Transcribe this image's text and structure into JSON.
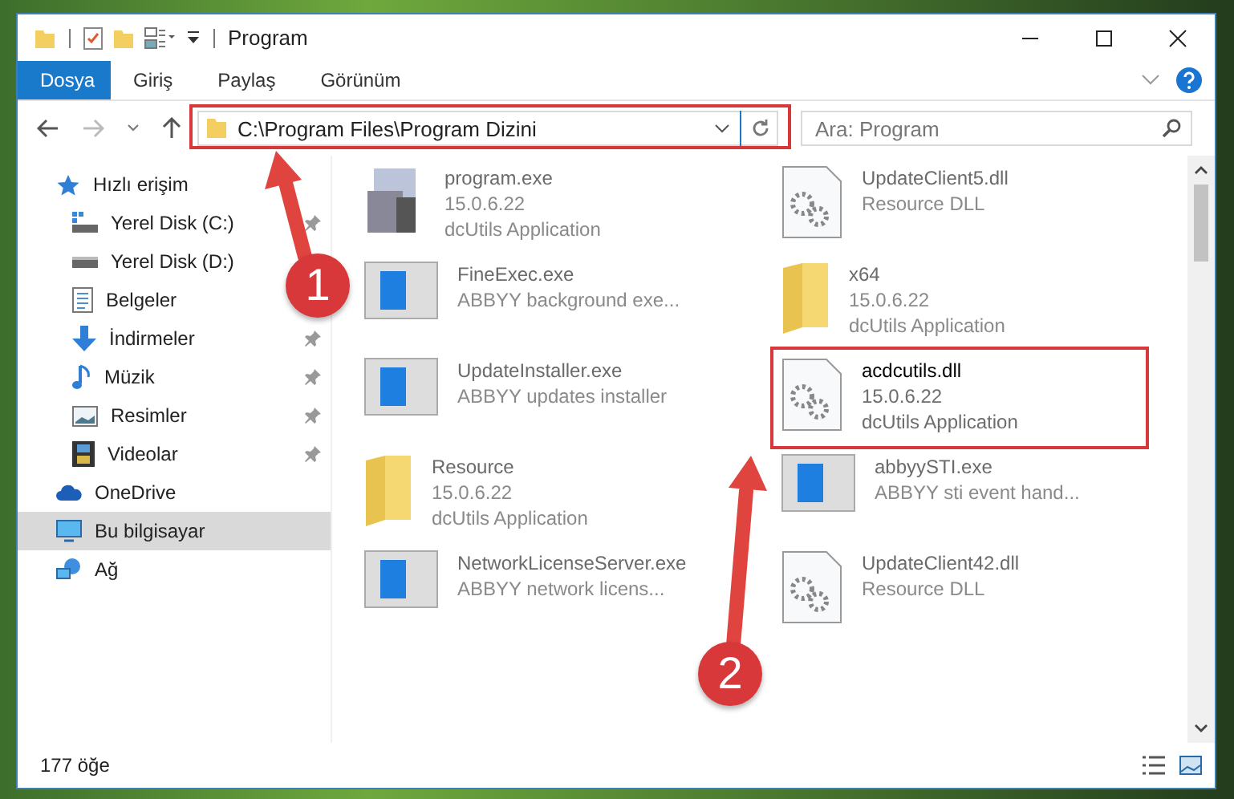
{
  "window": {
    "title": "Program"
  },
  "ribbon_tabs": [
    {
      "label": "Dosya",
      "selected": true
    },
    {
      "label": "Giriş",
      "selected": false
    },
    {
      "label": "Paylaş",
      "selected": false
    },
    {
      "label": "Görünüm",
      "selected": false
    }
  ],
  "address": {
    "path": "C:\\Program Files\\Program Dizini"
  },
  "search": {
    "placeholder": "Ara: Program"
  },
  "nav": [
    {
      "label": "Hızlı erişim",
      "kind": "star",
      "selected": false,
      "children": [
        {
          "label": "Yerel Disk (C:)",
          "kind": "system-drive",
          "pinned": true
        },
        {
          "label": "Yerel Disk (D:)",
          "kind": "drive",
          "pinned": false
        },
        {
          "label": "Belgeler",
          "kind": "documents",
          "pinned": false
        },
        {
          "label": "İndirmeler",
          "kind": "downloads",
          "pinned": true
        },
        {
          "label": "Müzik",
          "kind": "music",
          "pinned": true
        },
        {
          "label": "Resimler",
          "kind": "pictures",
          "pinned": true
        },
        {
          "label": "Videolar",
          "kind": "videos",
          "pinned": true
        }
      ]
    },
    {
      "label": "OneDrive",
      "kind": "cloud",
      "selected": false
    },
    {
      "label": "Bu bilgisayar",
      "kind": "computer",
      "selected": true
    },
    {
      "label": "Ağ",
      "kind": "network",
      "selected": false
    }
  ],
  "files": [
    {
      "kind": "exe",
      "name": "program.exe",
      "lines": [
        "15.0.6.22",
        "dcUtils Application"
      ],
      "blurred": true
    },
    {
      "kind": "dll",
      "name": "UpdateClient5.dll",
      "lines": [
        "Resource DLL"
      ],
      "blurred": true
    },
    {
      "kind": "app",
      "name": "FineExec.exe",
      "lines": [
        "ABBYY background exe..."
      ],
      "blurred": true
    },
    {
      "kind": "folder",
      "name": "x64",
      "lines": [
        "15.0.6.22",
        "dcUtils Application"
      ],
      "blurred": true
    },
    {
      "kind": "app",
      "name": "UpdateInstaller.exe",
      "lines": [
        "ABBYY updates installer"
      ],
      "blurred": true
    },
    {
      "kind": "dll",
      "name": "acdcutils.dll",
      "lines": [
        "15.0.6.22",
        "dcUtils Application"
      ],
      "blurred": false
    },
    {
      "kind": "folder",
      "name": "Resource",
      "lines": [
        "15.0.6.22",
        "dcUtils Application"
      ],
      "blurred": true
    },
    {
      "kind": "app",
      "name": "abbyySTI.exe",
      "lines": [
        "ABBYY sti event hand..."
      ],
      "blurred": true
    },
    {
      "kind": "app",
      "name": "NetworkLicenseServer.exe",
      "lines": [
        "ABBYY network licens..."
      ],
      "blurred": true
    },
    {
      "kind": "dll",
      "name": "UpdateClient42.dll",
      "lines": [
        "Resource DLL"
      ],
      "blurred": true
    }
  ],
  "status_bar": {
    "count": "177 öğe"
  },
  "annotations": [
    "1",
    "2"
  ]
}
